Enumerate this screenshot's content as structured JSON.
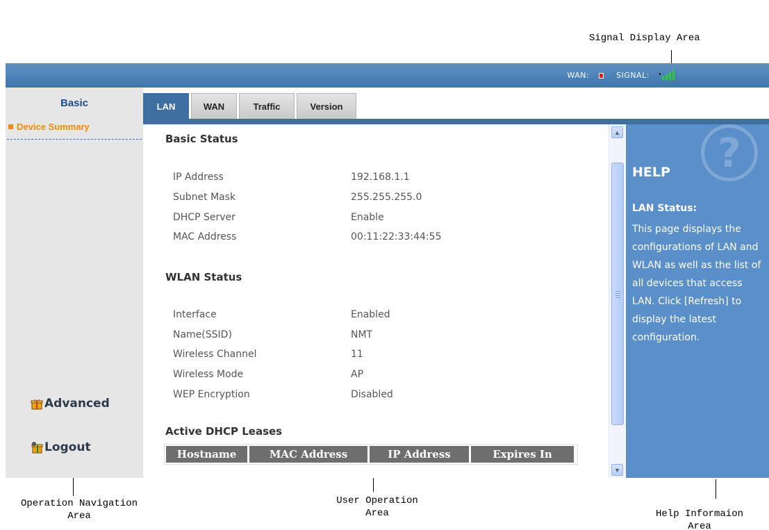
{
  "annotations": {
    "signal_area": "Signal Display Area",
    "nav_area": "Operation Navigation\nArea",
    "user_area": "User Operation\nArea",
    "help_area": "Help Informaion\nArea"
  },
  "topbar": {
    "wan_label": "WAN:",
    "signal_label": "SIGNAL:",
    "wan_status_color": "#e21b1b",
    "signal_color": "#2ecc2e"
  },
  "sidebar": {
    "title": "Basic",
    "items": [
      {
        "label": "Device Summary"
      }
    ],
    "advanced_label": "Advanced",
    "logout_label": "Logout",
    "accent": "#f28a0c"
  },
  "tabs": [
    {
      "label": "LAN",
      "active": true
    },
    {
      "label": "WAN",
      "active": false
    },
    {
      "label": "Traffic",
      "active": false
    },
    {
      "label": "Version",
      "active": false
    }
  ],
  "basic_status": {
    "title": "Basic Status",
    "rows": [
      {
        "label": "IP Address",
        "value": "192.168.1.1"
      },
      {
        "label": "Subnet Mask",
        "value": "255.255.255.0"
      },
      {
        "label": "DHCP Server",
        "value": "Enable"
      },
      {
        "label": "MAC Address",
        "value": "00:11:22:33:44:55"
      }
    ]
  },
  "wlan_status": {
    "title": "WLAN Status",
    "rows": [
      {
        "label": "Interface",
        "value": "Enabled"
      },
      {
        "label": "Name(SSID)",
        "value": "NMT"
      },
      {
        "label": "Wireless Channel",
        "value": "11"
      },
      {
        "label": "Wireless Mode",
        "value": "AP"
      },
      {
        "label": "WEP Encryption",
        "value": "Disabled"
      }
    ]
  },
  "dhcp_leases": {
    "title": "Active DHCP Leases",
    "columns": [
      "Hostname",
      "MAC Address",
      "IP Address",
      "Expires In"
    ]
  },
  "help": {
    "icon": "question-mark-icon",
    "title": "HELP",
    "subtitle": "LAN Status:",
    "body": "This page displays the configurations of LAN and WLAN as well as the list of all devices that access LAN. Click [Refresh] to display the latest configuration."
  }
}
